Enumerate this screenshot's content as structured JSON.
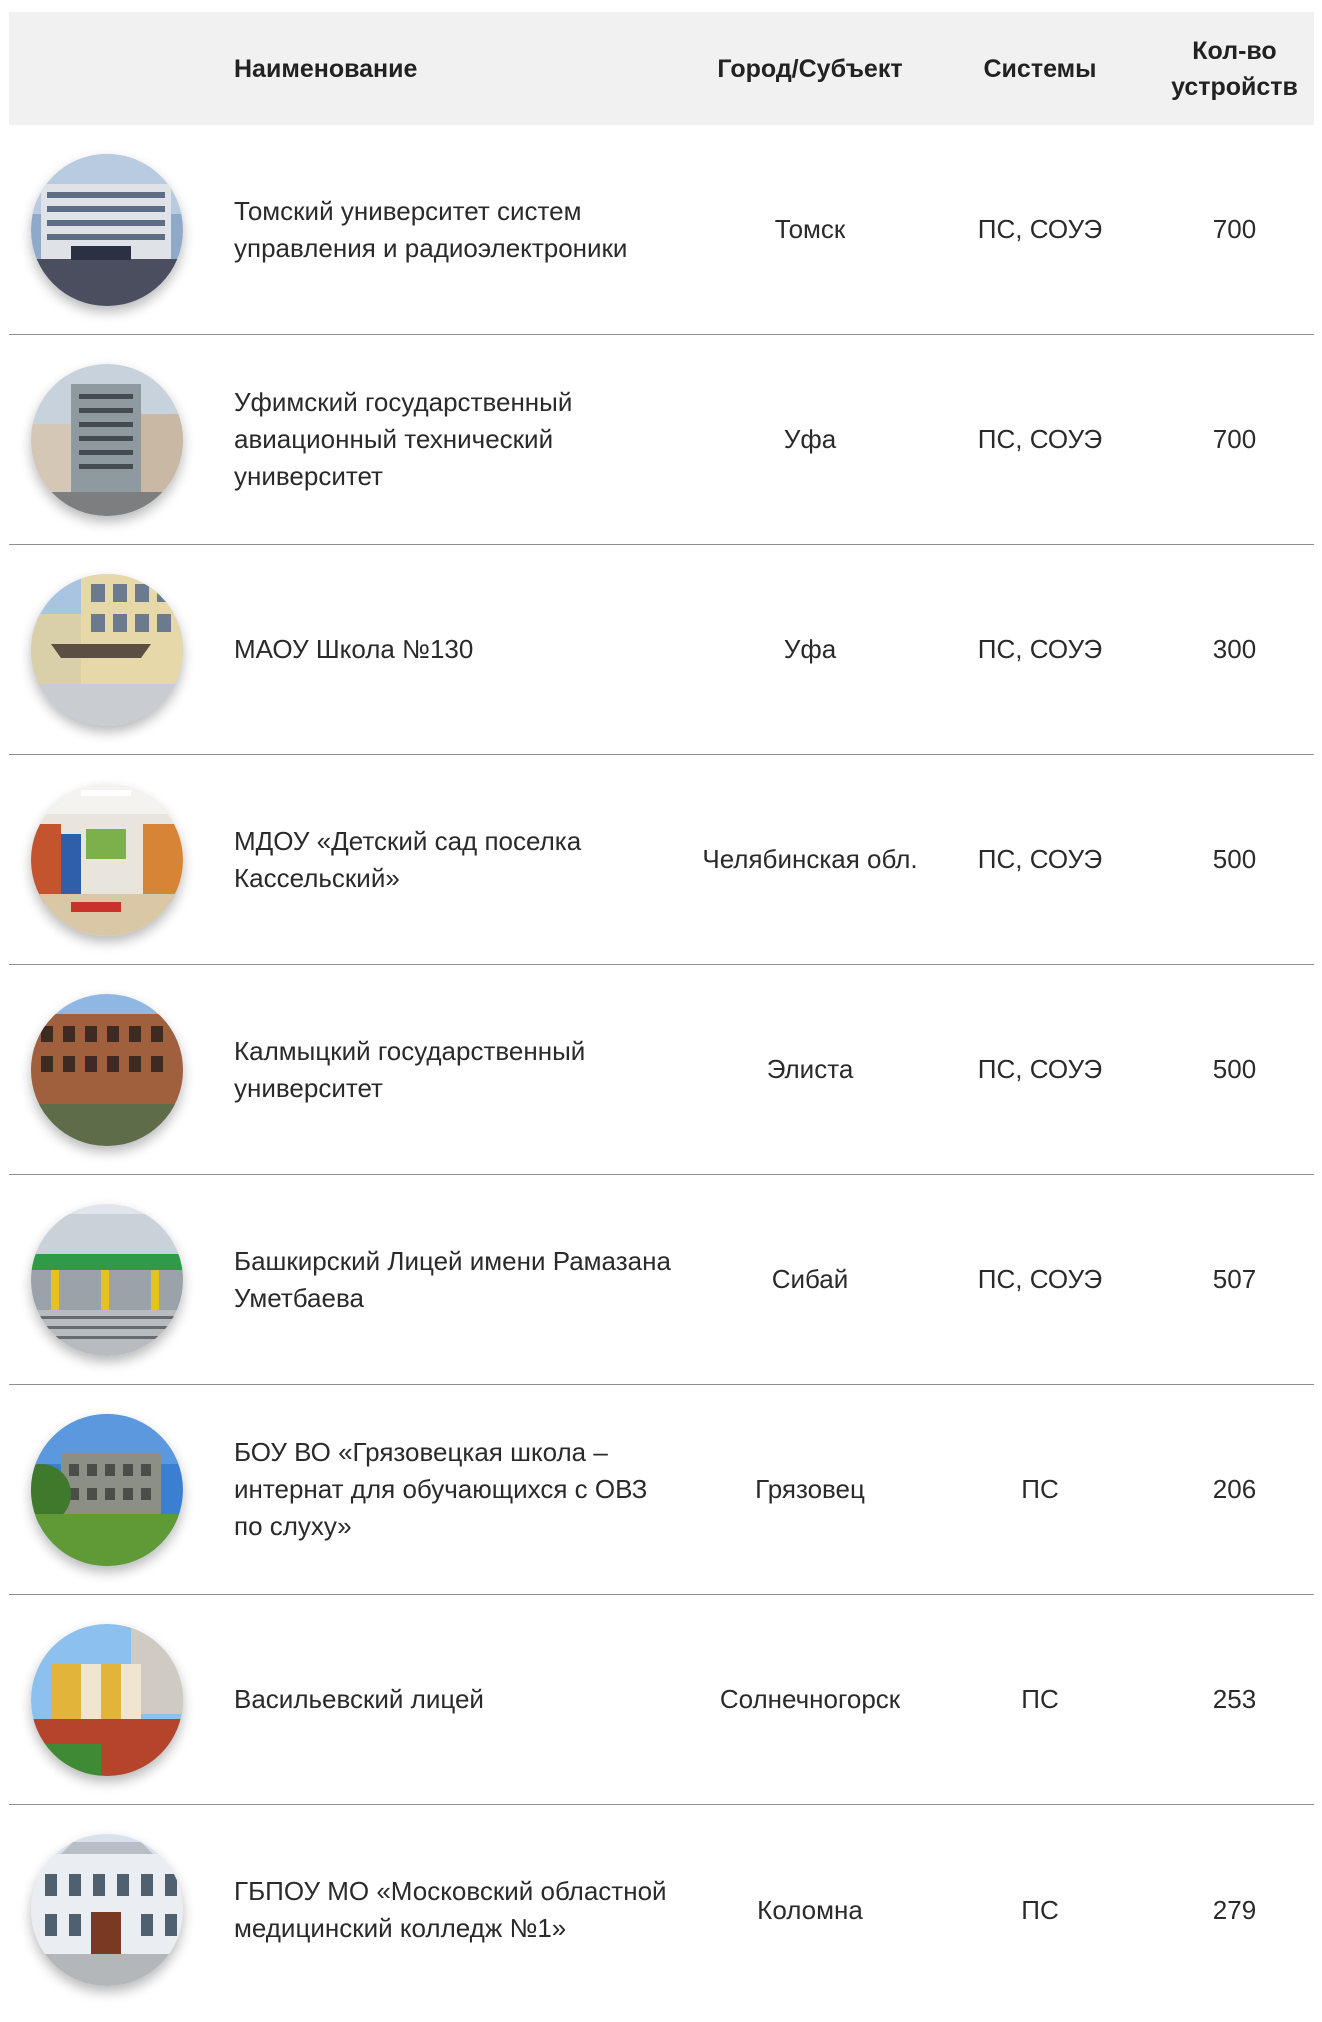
{
  "header": {
    "name": "Наименование",
    "city": "Город/Субъект",
    "systems": "Системы",
    "count": "Кол-во устройств"
  },
  "rows": [
    {
      "name": "Томский университет систем управления и радиоэлектроники",
      "city": "Томск",
      "systems": "ПС, СОУЭ",
      "count": "700",
      "photo": "university-building-photo"
    },
    {
      "name": "Уфимский государственный авиационный технический университет",
      "city": "Уфа",
      "systems": "ПС, СОУЭ",
      "count": "700",
      "photo": "university-tower-photo"
    },
    {
      "name": "МАОУ Школа №130",
      "city": "Уфа",
      "systems": "ПС, СОУЭ",
      "count": "300",
      "photo": "school-building-photo"
    },
    {
      "name": "МДОУ «Детский сад поселка Кассельский»",
      "city": "Челябинская обл.",
      "systems": "ПС, СОУЭ",
      "count": "500",
      "photo": "kindergarten-interior-photo"
    },
    {
      "name": "Калмыцкий государственный университет",
      "city": "Элиста",
      "systems": "ПС, СОУЭ",
      "count": "500",
      "photo": "brick-university-photo"
    },
    {
      "name": "Башкирский Лицей имени Рамазана Уметбаева",
      "city": "Сибай",
      "systems": "ПС, СОУЭ",
      "count": "507",
      "photo": "lyceum-entrance-photo"
    },
    {
      "name": "БОУ ВО «Грязовецкая школа – интернат для обучающихся с ОВЗ по слуху»",
      "city": "Грязовец",
      "systems": "ПС",
      "count": "206",
      "photo": "boarding-school-photo"
    },
    {
      "name": "Васильевский лицей",
      "city": "Солнечногорск",
      "systems": "ПС",
      "count": "253",
      "photo": "lyceum-playground-photo"
    },
    {
      "name": "ГБПОУ МО «Московский областной медицинский колледж №1»",
      "city": "Коломна",
      "systems": "ПС",
      "count": "279",
      "photo": "medical-college-photo"
    }
  ]
}
